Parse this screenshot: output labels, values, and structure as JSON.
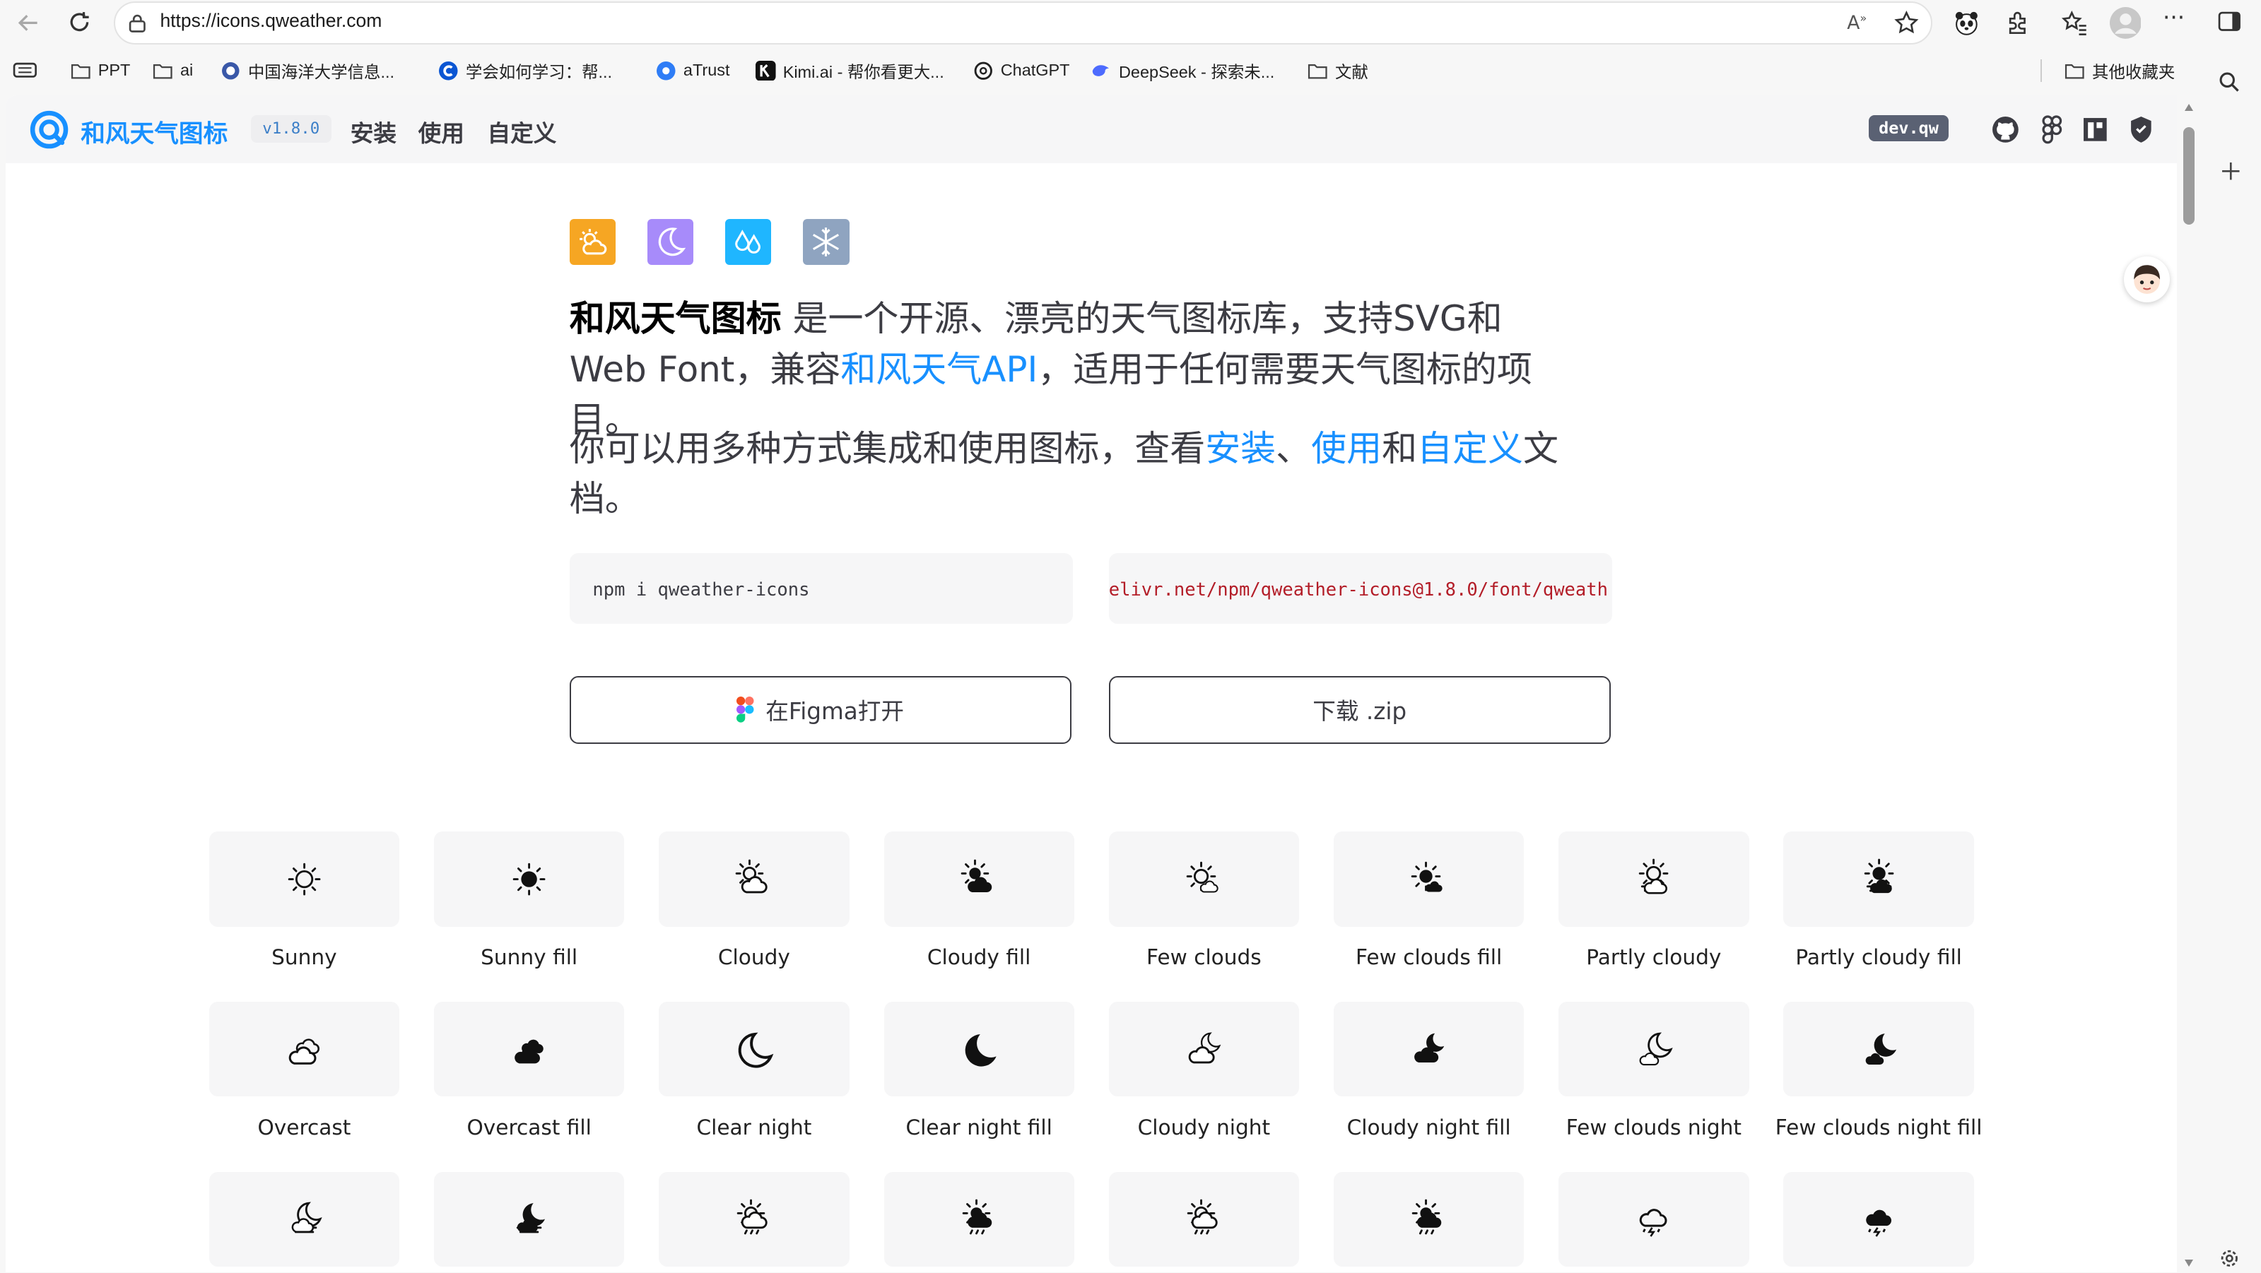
{
  "browser": {
    "url": "https://icons.qweather.com",
    "bookmarks": [
      {
        "label": "PPT",
        "icon": "folder-icon"
      },
      {
        "label": "ai",
        "icon": "folder-icon"
      },
      {
        "label": "中国海洋大学信息...",
        "icon": "globe-icon"
      },
      {
        "label": "学会如何学习：帮...",
        "icon": "c-logo-icon"
      },
      {
        "label": "aTrust",
        "icon": "atrust-icon"
      },
      {
        "label": "Kimi.ai - 帮你看更大...",
        "icon": "kimi-icon"
      },
      {
        "label": "ChatGPT",
        "icon": "chatgpt-icon"
      },
      {
        "label": "DeepSeek - 探索未...",
        "icon": "deepseek-icon"
      },
      {
        "label": "文献",
        "icon": "folder-icon"
      }
    ],
    "other_bookmarks": "其他收藏夹"
  },
  "site": {
    "brand": "和风天气图标",
    "version": "v1.8.0",
    "nav": [
      "安装",
      "使用",
      "自定义"
    ],
    "user_badge": "dev.qw"
  },
  "hero": {
    "intro_bold": "和风天气图标",
    "intro_1": " 是一个开源、漂亮的天气图标库，支持SVG和Web Font，兼容",
    "intro_link": "和风天气API",
    "intro_2": "，适用于任何需要天气图标的项目。",
    "p2_a": "你可以用多种方式集成和使用图标，查看",
    "p2_link1": "安装",
    "p2_sep": "、",
    "p2_link2": "使用",
    "p2_and": "和",
    "p2_link3": "自定义",
    "p2_b": "文档。"
  },
  "install": {
    "npm": "npm i qweather-icons",
    "cdn": "elivr.net/npm/qweather-icons@1.8.0/font/qweath"
  },
  "actions": {
    "figma": "在Figma打开",
    "download": "下载 .zip"
  },
  "icons": [
    {
      "name": "Sunny"
    },
    {
      "name": "Sunny fill"
    },
    {
      "name": "Cloudy"
    },
    {
      "name": "Cloudy fill"
    },
    {
      "name": "Few clouds"
    },
    {
      "name": "Few clouds fill"
    },
    {
      "name": "Partly cloudy"
    },
    {
      "name": "Partly cloudy fill"
    },
    {
      "name": "Overcast"
    },
    {
      "name": "Overcast fill"
    },
    {
      "name": "Clear night"
    },
    {
      "name": "Clear night fill"
    },
    {
      "name": "Cloudy night"
    },
    {
      "name": "Cloudy night fill"
    },
    {
      "name": "Few clouds night"
    },
    {
      "name": "Few clouds night fill"
    }
  ],
  "colors": {
    "brand": "#1890ff",
    "tile_sun": "#f6a623",
    "tile_moon": "#a78bfa",
    "tile_drop": "#1fb6ff",
    "tile_snow": "#8fa4c0",
    "code_cdn": "#b31d28"
  }
}
